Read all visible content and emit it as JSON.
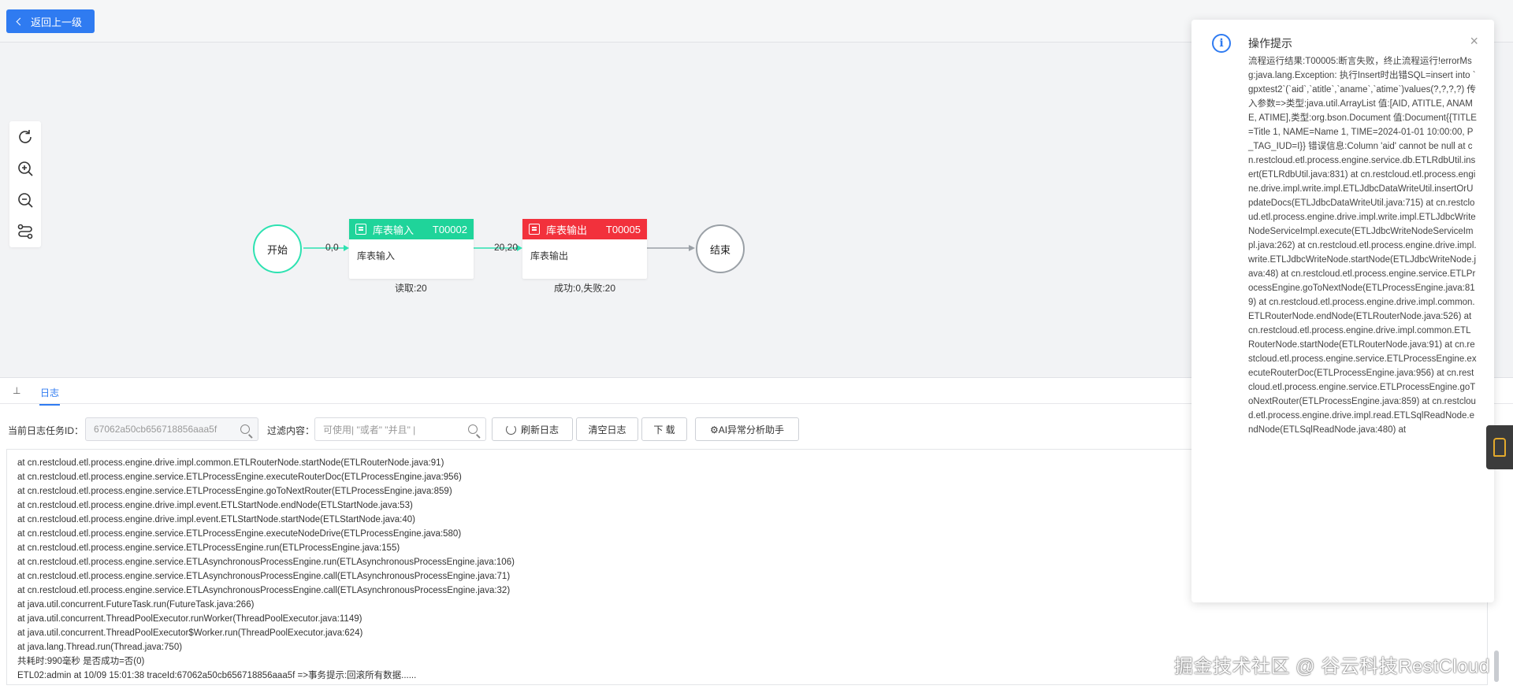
{
  "toolbar": {
    "back_label": "返回上一级"
  },
  "flow": {
    "start_label": "开始",
    "end_label": "结束",
    "edge1_label": "0,0",
    "edge2_label": "20,20",
    "nodes": [
      {
        "type": "库表输入",
        "code": "T00002",
        "body": "库表输入",
        "stat": "读取:20",
        "color": "#1fd49a"
      },
      {
        "type": "库表输出",
        "code": "T00005",
        "body": "库表输出",
        "stat": "成功:0,失败:20",
        "color": "#f2313c"
      }
    ]
  },
  "tabs": {
    "collapse_icon": "⊥",
    "log_tab": "日志"
  },
  "filters": {
    "task_id_label": "当前日志任务ID：",
    "task_id_value": "67062a50cb656718856aaa5f",
    "filter_label": "过滤内容：",
    "filter_placeholder": "可使用| \"或者\"  \"并且\" |",
    "refresh_btn": "刷新日志",
    "clear_btn": "清空日志",
    "download_btn": "下 载",
    "ai_btn": "⚙AI异常分析助手"
  },
  "log_lines": [
    "at cn.restcloud.etl.process.engine.drive.impl.common.ETLRouterNode.startNode(ETLRouterNode.java:91)",
    "at cn.restcloud.etl.process.engine.service.ETLProcessEngine.executeRouterDoc(ETLProcessEngine.java:956)",
    "at cn.restcloud.etl.process.engine.service.ETLProcessEngine.goToNextRouter(ETLProcessEngine.java:859)",
    "at cn.restcloud.etl.process.engine.drive.impl.event.ETLStartNode.endNode(ETLStartNode.java:53)",
    "at cn.restcloud.etl.process.engine.drive.impl.event.ETLStartNode.startNode(ETLStartNode.java:40)",
    "at cn.restcloud.etl.process.engine.service.ETLProcessEngine.executeNodeDrive(ETLProcessEngine.java:580)",
    "at cn.restcloud.etl.process.engine.service.ETLProcessEngine.run(ETLProcessEngine.java:155)",
    "at cn.restcloud.etl.process.engine.service.ETLAsynchronousProcessEngine.run(ETLAsynchronousProcessEngine.java:106)",
    "at cn.restcloud.etl.process.engine.service.ETLAsynchronousProcessEngine.call(ETLAsynchronousProcessEngine.java:71)",
    "at cn.restcloud.etl.process.engine.service.ETLAsynchronousProcessEngine.call(ETLAsynchronousProcessEngine.java:32)",
    "at java.util.concurrent.FutureTask.run(FutureTask.java:266)",
    "at java.util.concurrent.ThreadPoolExecutor.runWorker(ThreadPoolExecutor.java:1149)",
    "at java.util.concurrent.ThreadPoolExecutor$Worker.run(ThreadPoolExecutor.java:624)",
    "at java.lang.Thread.run(Thread.java:750)",
    "共耗时:990毫秒 是否成功=否(0)",
    "ETL02:admin at 10/09 15:01:38 traceId:67062a50cb656718856aaa5f =>事务提示:回滚所有数据......"
  ],
  "notice": {
    "title": "操作提示",
    "close_icon": "×",
    "body": "流程运行结果:T00005:断言失败，终止流程运行!errorMsg:java.lang.Exception: 执行Insert时出错SQL=insert into `gpxtest2`(`aid`,`atitle`,`aname`,`atime`)values(?,?,?,?) 传入参数=>类型:java.util.ArrayList 值:[AID, ATITLE, ANAME, ATIME],类型:org.bson.Document 值:Document{{TITLE=Title 1, NAME=Name 1, TIME=2024-01-01 10:00:00, P_TAG_IUD=I}} 错误信息:Column 'aid' cannot be null at cn.restcloud.etl.process.engine.service.db.ETLRdbUtil.insert(ETLRdbUtil.java:831) at cn.restcloud.etl.process.engine.drive.impl.write.impl.ETLJdbcDataWriteUtil.insertOrUpdateDocs(ETLJdbcDataWriteUtil.java:715) at cn.restcloud.etl.process.engine.drive.impl.write.impl.ETLJdbcWriteNodeServiceImpl.execute(ETLJdbcWriteNodeServiceImpl.java:262) at cn.restcloud.etl.process.engine.drive.impl.write.ETLJdbcWriteNode.startNode(ETLJdbcWriteNode.java:48) at cn.restcloud.etl.process.engine.service.ETLProcessEngine.goToNextNode(ETLProcessEngine.java:819) at cn.restcloud.etl.process.engine.drive.impl.common.ETLRouterNode.endNode(ETLRouterNode.java:526) at cn.restcloud.etl.process.engine.drive.impl.common.ETLRouterNode.startNode(ETLRouterNode.java:91) at cn.restcloud.etl.process.engine.service.ETLProcessEngine.executeRouterDoc(ETLProcessEngine.java:956) at cn.restcloud.etl.process.engine.service.ETLProcessEngine.goToNextRouter(ETLProcessEngine.java:859) at cn.restcloud.etl.process.engine.drive.impl.read.ETLSqlReadNode.endNode(ETLSqlReadNode.java:480) at"
  },
  "watermark": "掘金技术社区 @ 谷云科技RestCloud",
  "colors": {
    "primary": "#2f7bf1",
    "start_node": "#2de2b1",
    "end_node": "#9aa0a6"
  }
}
